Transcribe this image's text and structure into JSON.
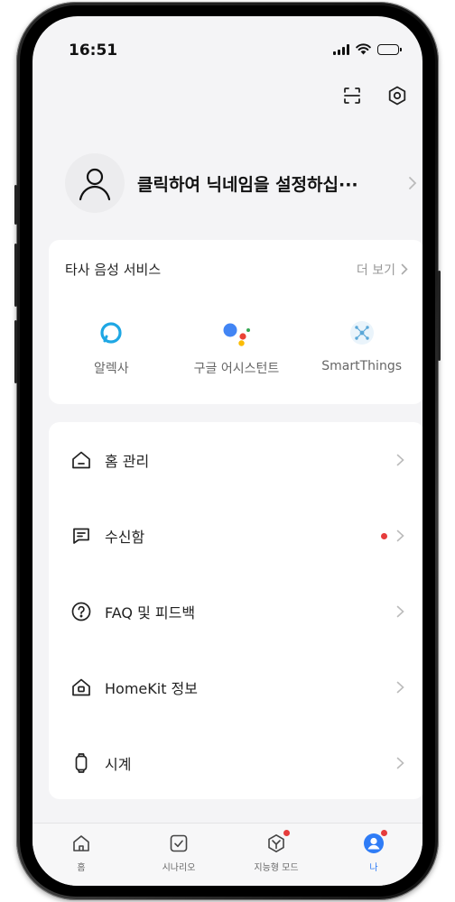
{
  "status_bar": {
    "time": "16:51",
    "battery_level": 0.45
  },
  "profile": {
    "nickname": "클릭하여 닉네임을 설정하십···"
  },
  "voice_services": {
    "title": "타사 음성 서비스",
    "more_label": "더 보기",
    "items": [
      {
        "label": "알렉사",
        "icon": "alexa-icon"
      },
      {
        "label": "구글 어시스턴트",
        "icon": "google-assistant-icon"
      },
      {
        "label": "SmartThings",
        "icon": "smartthings-icon"
      }
    ]
  },
  "menu": {
    "items": [
      {
        "label": "홈 관리",
        "icon": "home-icon",
        "has_dot": false
      },
      {
        "label": "수신함",
        "icon": "inbox-icon",
        "has_dot": true
      },
      {
        "label": "FAQ 및 피드백",
        "icon": "help-icon",
        "has_dot": false
      },
      {
        "label": "HomeKit 정보",
        "icon": "homekit-icon",
        "has_dot": false
      },
      {
        "label": "시계",
        "icon": "watch-icon",
        "has_dot": false
      }
    ]
  },
  "tabbar": {
    "tabs": [
      {
        "label": "홈",
        "icon": "home-tab-icon",
        "active": false,
        "badge": false
      },
      {
        "label": "시나리오",
        "icon": "scenario-icon",
        "active": false,
        "badge": false
      },
      {
        "label": "지능형 모드",
        "icon": "smart-mode-icon",
        "active": false,
        "badge": true
      },
      {
        "label": "나",
        "icon": "me-icon",
        "active": true,
        "badge": true
      }
    ]
  },
  "colors": {
    "accent": "#2f7cf6",
    "badge": "#e63c3c",
    "background": "#f4f4f6",
    "card": "#ffffff"
  }
}
